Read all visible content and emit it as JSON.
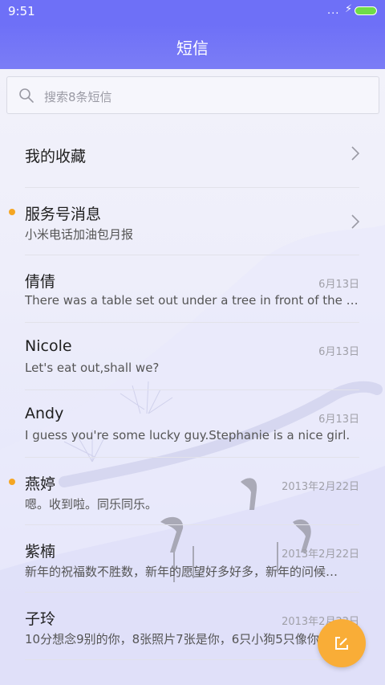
{
  "status_bar": {
    "time": "9:51",
    "signal": "...",
    "charging": "⚡"
  },
  "header": {
    "title": "短信"
  },
  "search": {
    "placeholder": "搜索8条短信"
  },
  "favorites": {
    "label": "我的收藏"
  },
  "service": {
    "title": "服务号消息",
    "preview": "小米电话加油包月报",
    "unread": true
  },
  "threads": [
    {
      "name": "倩倩",
      "date": "6月13日",
      "preview": "There was a table set out under a tree in front of the ho…",
      "unread": false
    },
    {
      "name": "Nicole",
      "date": "6月13日",
      "preview": "Let's eat out,shall we?",
      "unread": false
    },
    {
      "name": "Andy",
      "date": "6月13日",
      "preview": "I guess you're some lucky guy.Stephanie is a nice girl.",
      "unread": false
    },
    {
      "name": "燕婷",
      "date": "2013年2月22日",
      "preview": "嗯。收到啦。同乐同乐。",
      "unread": true
    },
    {
      "name": "紫楠",
      "date": "2013年2月22日",
      "preview": "新年的祝福数不胜数，新年的愿望好多好多，新年的问候…",
      "unread": false
    },
    {
      "name": "子玲",
      "date": "2013年2月22日",
      "preview": "10分想念9别的你，8张照片7张是你，6只小狗5只像你",
      "unread": false
    }
  ],
  "colors": {
    "accent": "#6e70f7",
    "unread_dot": "#f5a623",
    "fab": "#f9ad37"
  },
  "icons": {
    "search": "search-icon",
    "chevron": "chevron-right-icon",
    "compose": "compose-icon"
  }
}
